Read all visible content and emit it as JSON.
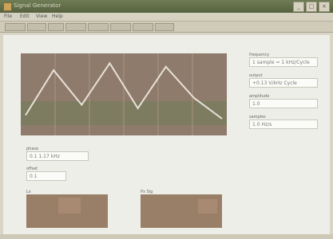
{
  "window": {
    "title": "Signal Generator",
    "minimize": "_",
    "maximize": "□",
    "close": "×"
  },
  "menu": [
    "File",
    "Edit",
    "View",
    "Help"
  ],
  "chart_data": {
    "type": "line",
    "series": [
      {
        "values": [
          0.2,
          0.85,
          0.35,
          0.95,
          0.3,
          0.9,
          0.45,
          0.15
        ]
      }
    ]
  },
  "fields": {
    "field_1": {
      "label": "frequency",
      "value": "1 sample = 1 kHz/Cycle"
    },
    "field_2": {
      "label": "output",
      "value": "+0.13 V/kHz Cycle"
    },
    "field_3": {
      "label": "amplitude",
      "value": "1.0"
    },
    "field_4": {
      "label": "samples",
      "value": "1.0 Hz/s"
    },
    "field_5": {
      "label": "phase",
      "value": "0.1 1.17 kHz"
    },
    "field_6": {
      "label": "offset",
      "value": "0.1"
    }
  },
  "panels": {
    "left_label": "Lx",
    "right_label": "Px Sig"
  }
}
